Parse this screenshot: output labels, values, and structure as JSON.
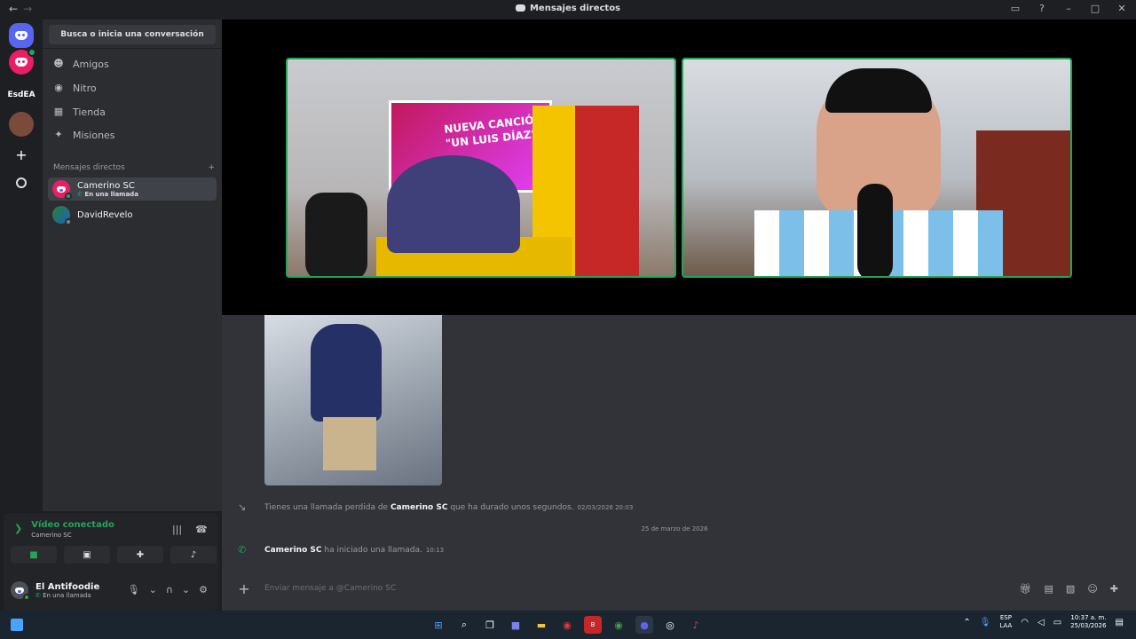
{
  "titlebar": {
    "back": "←",
    "forward": "→",
    "title": "Mensajes directos"
  },
  "guilds": {
    "server_label": "EsdEA"
  },
  "sidebar": {
    "search_label": "Busca o inicia una conversación",
    "nav": [
      {
        "label": "Amigos",
        "icon": "friends-icon"
      },
      {
        "label": "Nitro",
        "icon": "nitro-icon"
      },
      {
        "label": "Tienda",
        "icon": "shop-icon"
      },
      {
        "label": "Misiones",
        "icon": "quests-icon"
      }
    ],
    "dm_header": "Mensajes directos",
    "dm_add": "+",
    "dms": [
      {
        "name": "Camerino SC",
        "status": "En una llamada",
        "active": true
      },
      {
        "name": "DavidRevelo",
        "status": "",
        "active": false
      }
    ]
  },
  "voice": {
    "title": "Vídeo conectado",
    "channel": "Camerino SC"
  },
  "user": {
    "name": "El Antifoodie",
    "status": "En una llamada"
  },
  "stage": {
    "poster_line1": "NUEVA CANCIÓN",
    "poster_line2": "\"UN LUIS DÍAZ\""
  },
  "chat": {
    "missed_prefix": "Tienes una llamada perdida de",
    "missed_user": "Camerino SC",
    "missed_suffix": "que ha durado unos segundos.",
    "missed_ts": "02/03/2026 20:03",
    "date_divider": "25 de marzo de 2026",
    "call_user": "Camerino SC",
    "call_text": "ha iniciado una llamada.",
    "call_ts": "10:13",
    "composer_placeholder": "Enviar mensaje a @Camerino SC"
  },
  "taskbar": {
    "lang_top": "ESP",
    "lang_bottom": "LAA",
    "time": "10:37 a. m.",
    "date": "25/03/2026"
  },
  "colors": {
    "accent": "#5865f2",
    "green": "#23a55a",
    "bg": "#313338"
  }
}
